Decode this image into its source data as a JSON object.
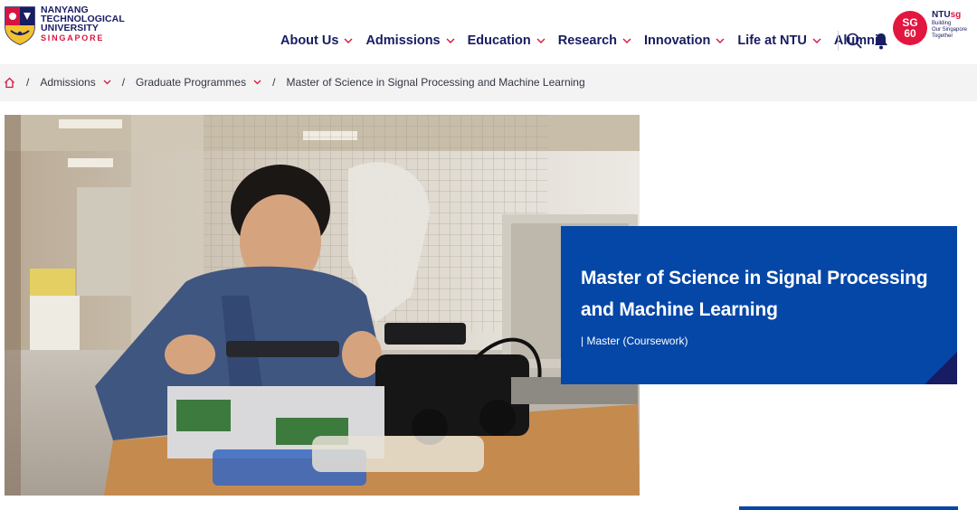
{
  "header": {
    "logo": {
      "line1": "NANYANG",
      "line2": "TECHNOLOGICAL",
      "line3": "UNIVERSITY",
      "line4": "SINGAPORE"
    },
    "nav": [
      {
        "label": "About Us",
        "has_dropdown": true
      },
      {
        "label": "Admissions",
        "has_dropdown": true
      },
      {
        "label": "Education",
        "has_dropdown": true
      },
      {
        "label": "Research",
        "has_dropdown": true
      },
      {
        "label": "Innovation",
        "has_dropdown": true
      },
      {
        "label": "Life at NTU",
        "has_dropdown": true
      },
      {
        "label": "Alumni",
        "has_dropdown": false
      }
    ],
    "icons": {
      "search": "search-icon",
      "notifications": "bell-icon"
    },
    "sg60": {
      "badge_top": "SG",
      "badge_bottom": "60",
      "brand_ntu": "NTU",
      "brand_sg": "sg",
      "tagline1": "Building",
      "tagline2": "Our Singapore",
      "tagline3": "Together"
    }
  },
  "breadcrumb": {
    "home_icon": "home-icon",
    "items": [
      {
        "label": "Admissions"
      },
      {
        "label": "Graduate Programmes"
      },
      {
        "label": "Master of Science in Signal Processing and Machine Learning"
      }
    ]
  },
  "hero": {
    "title": "Master of Science in Signal Processing and Machine Learning",
    "subtitle": "| Master (Coursework)"
  },
  "colors": {
    "navy": "#181c62",
    "brand_red": "#d71440",
    "card_blue": "#0547a7",
    "crumb_bg": "#f3f3f3"
  }
}
